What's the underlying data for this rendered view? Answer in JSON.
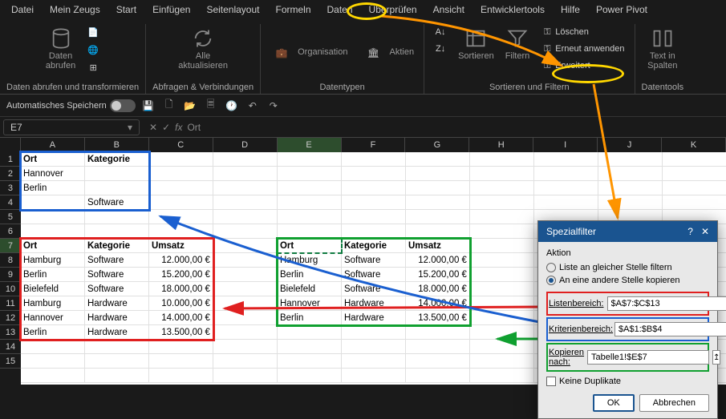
{
  "menu": {
    "items": [
      "Datei",
      "Mein Zeugs",
      "Start",
      "Einfügen",
      "Seitenlayout",
      "Formeln",
      "Daten",
      "Überprüfen",
      "Ansicht",
      "Entwicklertools",
      "Hilfe",
      "Power Pivot"
    ],
    "active": "Daten"
  },
  "ribbon": {
    "g1": {
      "label": "Daten abrufen und transformieren",
      "btn1": "Daten\nabrufen"
    },
    "g2": {
      "label": "Abfragen & Verbindungen",
      "btn1": "Alle\naktualisieren"
    },
    "g3": {
      "label": "Datentypen",
      "btn1": "Organisation",
      "btn2": "Aktien"
    },
    "g4": {
      "label": "Sortieren und Filtern",
      "btn1": "Sortieren",
      "btn2": "Filtern",
      "s1": "Löschen",
      "s2": "Erneut anwenden",
      "s3": "Erweitert"
    },
    "g5": {
      "label": "Datentools",
      "btn1": "Text in\nSpalten"
    }
  },
  "qat": {
    "autosave": "Automatisches Speichern"
  },
  "formula": {
    "name": "E7",
    "value": "Ort"
  },
  "cols": [
    "A",
    "B",
    "C",
    "D",
    "E",
    "F",
    "G",
    "H",
    "I",
    "J",
    "K"
  ],
  "rows": [
    "1",
    "2",
    "3",
    "4",
    "5",
    "6",
    "7",
    "8",
    "9",
    "10",
    "11",
    "12",
    "13",
    "14",
    "15"
  ],
  "criteria": {
    "h": [
      "Ort",
      "Kategorie"
    ],
    "r": [
      [
        "Hannover",
        ""
      ],
      [
        "Berlin",
        ""
      ],
      [
        "",
        "Software"
      ]
    ]
  },
  "source": {
    "h": [
      "Ort",
      "Kategorie",
      "Umsatz"
    ],
    "r": [
      [
        "Hamburg",
        "Software",
        "12.000,00 €"
      ],
      [
        "Berlin",
        "Software",
        "15.200,00 €"
      ],
      [
        "Bielefeld",
        "Software",
        "18.000,00 €"
      ],
      [
        "Hamburg",
        "Hardware",
        "10.000,00 €"
      ],
      [
        "Hannover",
        "Hardware",
        "14.000,00 €"
      ],
      [
        "Berlin",
        "Hardware",
        "13.500,00 €"
      ]
    ]
  },
  "target": {
    "h": [
      "Ort",
      "Kategorie",
      "Umsatz"
    ],
    "r": [
      [
        "Hamburg",
        "Software",
        "12.000,00 €"
      ],
      [
        "Berlin",
        "Software",
        "15.200,00 €"
      ],
      [
        "Bielefeld",
        "Software",
        "18.000,00 €"
      ],
      [
        "Hannover",
        "Hardware",
        "14.000,00 €"
      ],
      [
        "Berlin",
        "Hardware",
        "13.500,00 €"
      ]
    ]
  },
  "dialog": {
    "title": "Spezialfilter",
    "section": "Aktion",
    "opt1": "Liste an gleicher Stelle filtern",
    "opt2": "An eine andere Stelle kopieren",
    "f1": {
      "label": "Listenbereich:",
      "value": "$A$7:$C$13"
    },
    "f2": {
      "label": "Kriterienbereich:",
      "value": "$A$1:$B$4"
    },
    "f3": {
      "label": "Kopieren nach:",
      "value": "Tabelle1!$E$7"
    },
    "dup": "Keine Duplikate",
    "ok": "OK",
    "cancel": "Abbrechen"
  },
  "colors": {
    "red": "#e02020",
    "blue": "#1a5fd0",
    "green": "#10a030",
    "orange": "#ff9500",
    "yellow": "#ffd700"
  }
}
